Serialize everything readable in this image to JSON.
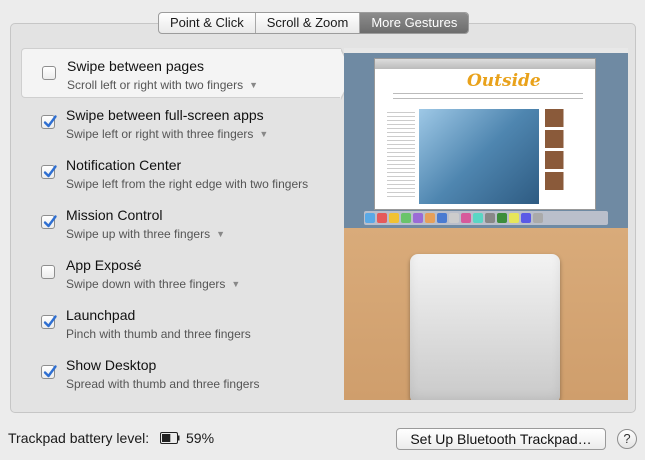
{
  "tabs": [
    {
      "label": "Point & Click",
      "active": false
    },
    {
      "label": "Scroll & Zoom",
      "active": false
    },
    {
      "label": "More Gestures",
      "active": true
    }
  ],
  "gestures": [
    {
      "title": "Swipe between pages",
      "subtitle": "Scroll left or right with two fingers",
      "checked": false,
      "has_menu": true,
      "selected": true
    },
    {
      "title": "Swipe between full-screen apps",
      "subtitle": "Swipe left or right with three fingers",
      "checked": true,
      "has_menu": true,
      "selected": false
    },
    {
      "title": "Notification Center",
      "subtitle": "Swipe left from the right edge with two fingers",
      "checked": true,
      "has_menu": false,
      "selected": false
    },
    {
      "title": "Mission Control",
      "subtitle": "Swipe up with three fingers",
      "checked": true,
      "has_menu": true,
      "selected": false
    },
    {
      "title": "App Exposé",
      "subtitle": "Swipe down with three fingers",
      "checked": false,
      "has_menu": true,
      "selected": false
    },
    {
      "title": "Launchpad",
      "subtitle": "Pinch with thumb and three fingers",
      "checked": true,
      "has_menu": false,
      "selected": false
    },
    {
      "title": "Show Desktop",
      "subtitle": "Spread with thumb and three fingers",
      "checked": true,
      "has_menu": false,
      "selected": false
    }
  ],
  "preview": {
    "magazine_title": "Outside"
  },
  "footer": {
    "battery_label": "Trackpad battery level:",
    "battery_percent": "59%",
    "battery_level": 0.59,
    "setup_button": "Set Up Bluetooth Trackpad…",
    "help_button": "?"
  },
  "colors": {
    "checkbox_checked": "#2f6fd1",
    "active_tab": "#7a7a7a",
    "accent_orange": "#e9a21b"
  },
  "icons": {
    "checkmark": "checkmark-icon",
    "dropdown": "chevron-down-icon",
    "battery": "battery-icon"
  }
}
